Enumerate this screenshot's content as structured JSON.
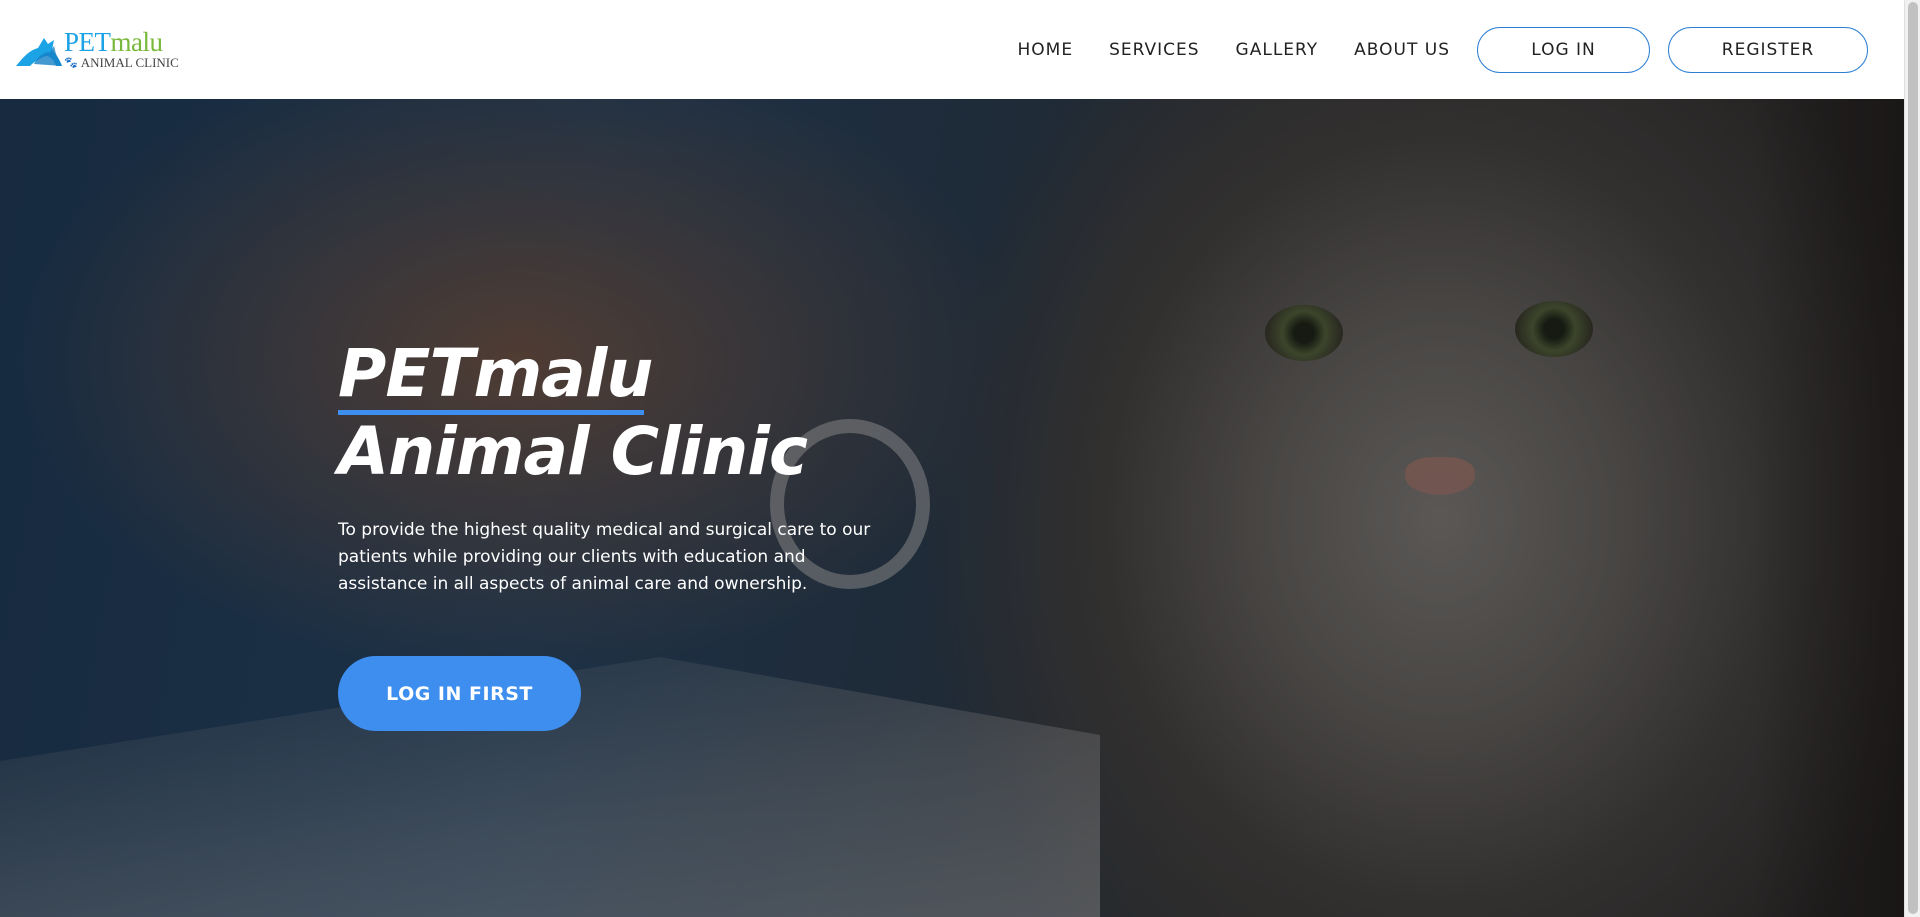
{
  "brand": {
    "logo_icon": "pet-silhouette-icon",
    "name_part1": "PET",
    "name_part2": "malu",
    "subtitle": "ANIMAL CLINIC",
    "paw_icon": "paw-icon",
    "colors": {
      "pet": "#1ca3e6",
      "malu": "#79b83b"
    }
  },
  "nav": {
    "links": [
      {
        "label": "HOME"
      },
      {
        "label": "SERVICES"
      },
      {
        "label": "GALLERY"
      },
      {
        "label": "ABOUT US"
      }
    ],
    "login_label": "LOG IN",
    "register_label": "REGISTER"
  },
  "hero": {
    "title_line1": "PETmalu",
    "title_line2": "Animal Clinic",
    "description": "To provide the highest quality medical and surgical care to our patients while providing our clients with education and assistance in all aspects of animal care and ownership.",
    "cta_label": "LOG IN FIRST",
    "accent_color": "#3d8eef"
  }
}
